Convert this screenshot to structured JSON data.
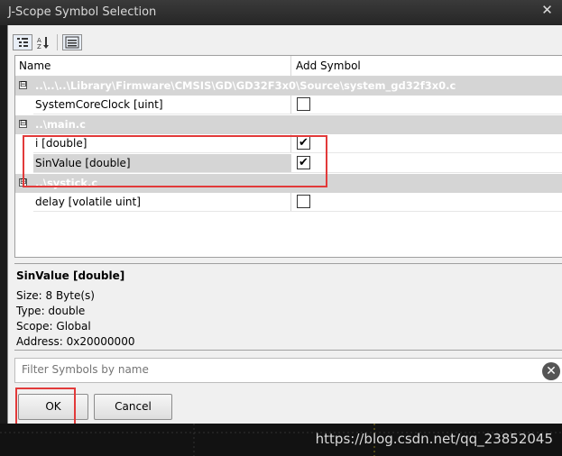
{
  "window": {
    "title": "J-Scope Symbol Selection",
    "close_glyph": "✕"
  },
  "columns": {
    "name": "Name",
    "add_symbol": "Add Symbol"
  },
  "groups": [
    {
      "label": "..\\..\\..\\Library\\Firmware\\CMSIS\\GD\\GD32F3x0\\Source\\system_gd32f3x0.c",
      "items": [
        {
          "name": "SystemCoreClock [uint]",
          "checked": false
        }
      ]
    },
    {
      "label": "..\\main.c",
      "items": [
        {
          "name": "i [double]",
          "checked": true
        },
        {
          "name": "SinValue [double]",
          "checked": true
        }
      ]
    },
    {
      "label": "..\\systick.c",
      "items": [
        {
          "name": "delay [volatile uint]",
          "checked": false
        }
      ]
    }
  ],
  "details": {
    "title": "SinValue [double]",
    "size": "Size:  8 Byte(s)",
    "type": "Type:  double",
    "scope": "Scope:  Global",
    "address": "Address: 0x20000000"
  },
  "filter": {
    "placeholder": "Filter Symbols by name",
    "value": ""
  },
  "buttons": {
    "ok": "OK",
    "cancel": "Cancel"
  },
  "icons": {
    "expander": "⊟",
    "check": "✔",
    "clear": "✕"
  },
  "watermark": "https://blog.csdn.net/qq_23852045",
  "colors": {
    "highlight_box": "#e23a3a"
  }
}
